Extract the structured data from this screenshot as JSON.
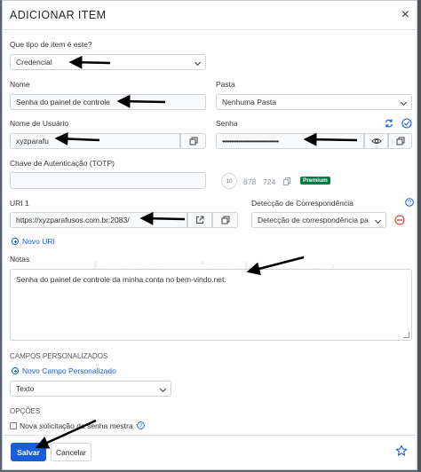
{
  "dialog": {
    "title": "ADICIONAR ITEM",
    "close_glyph": "×"
  },
  "form": {
    "type_label": "Que tipo de item é este?",
    "type_value": "Credencial",
    "name_label": "Nome",
    "name_value": "Senha do painel de controle",
    "folder_label": "Pasta",
    "folder_value": "Nenhuma Pasta",
    "username_label": "Nome de Usuário",
    "username_value": "xyzparafu",
    "password_label": "Senha",
    "password_value": "••••••••••••••••••••••••••••••••",
    "totp_label": "Chave de Autenticação (TOTP)",
    "totp_timer": "10",
    "totp_code_1": "878",
    "totp_code_2": "724",
    "premium_badge": "Premium",
    "uri_label": "URI 1",
    "uri_value": "https://xyzparafusos.com.br:2083/",
    "match_label": "Detecção de Correspondência",
    "match_value": "Detecção de correspondência pa",
    "new_uri_link": "Novo URI",
    "notes_label": "Notas",
    "notes_value": "Senha do painel de controle da minha conta no bem-vindo.net.",
    "custom_fields_heading": "CAMPOS PERSONALIZADOS",
    "new_custom_field_link": "Novo Campo Personalizado",
    "custom_field_type": "Texto",
    "options_heading": "OPÇÕES",
    "reprompt_label": "Nova solicitação da senha mestra"
  },
  "footer": {
    "save_label": "Salvar",
    "cancel_label": "Cancelar"
  },
  "watermark": "bem-vindo.net",
  "colors": {
    "primary": "#175ddc",
    "premium": "#017e45",
    "danger": "#dd4b39"
  },
  "icons": [
    "copy-icon",
    "eye-icon",
    "refresh-icon",
    "check-circle-icon",
    "clock-icon",
    "launch-icon",
    "help-icon",
    "remove-icon",
    "star-icon",
    "close-icon",
    "plus-circle-icon"
  ]
}
